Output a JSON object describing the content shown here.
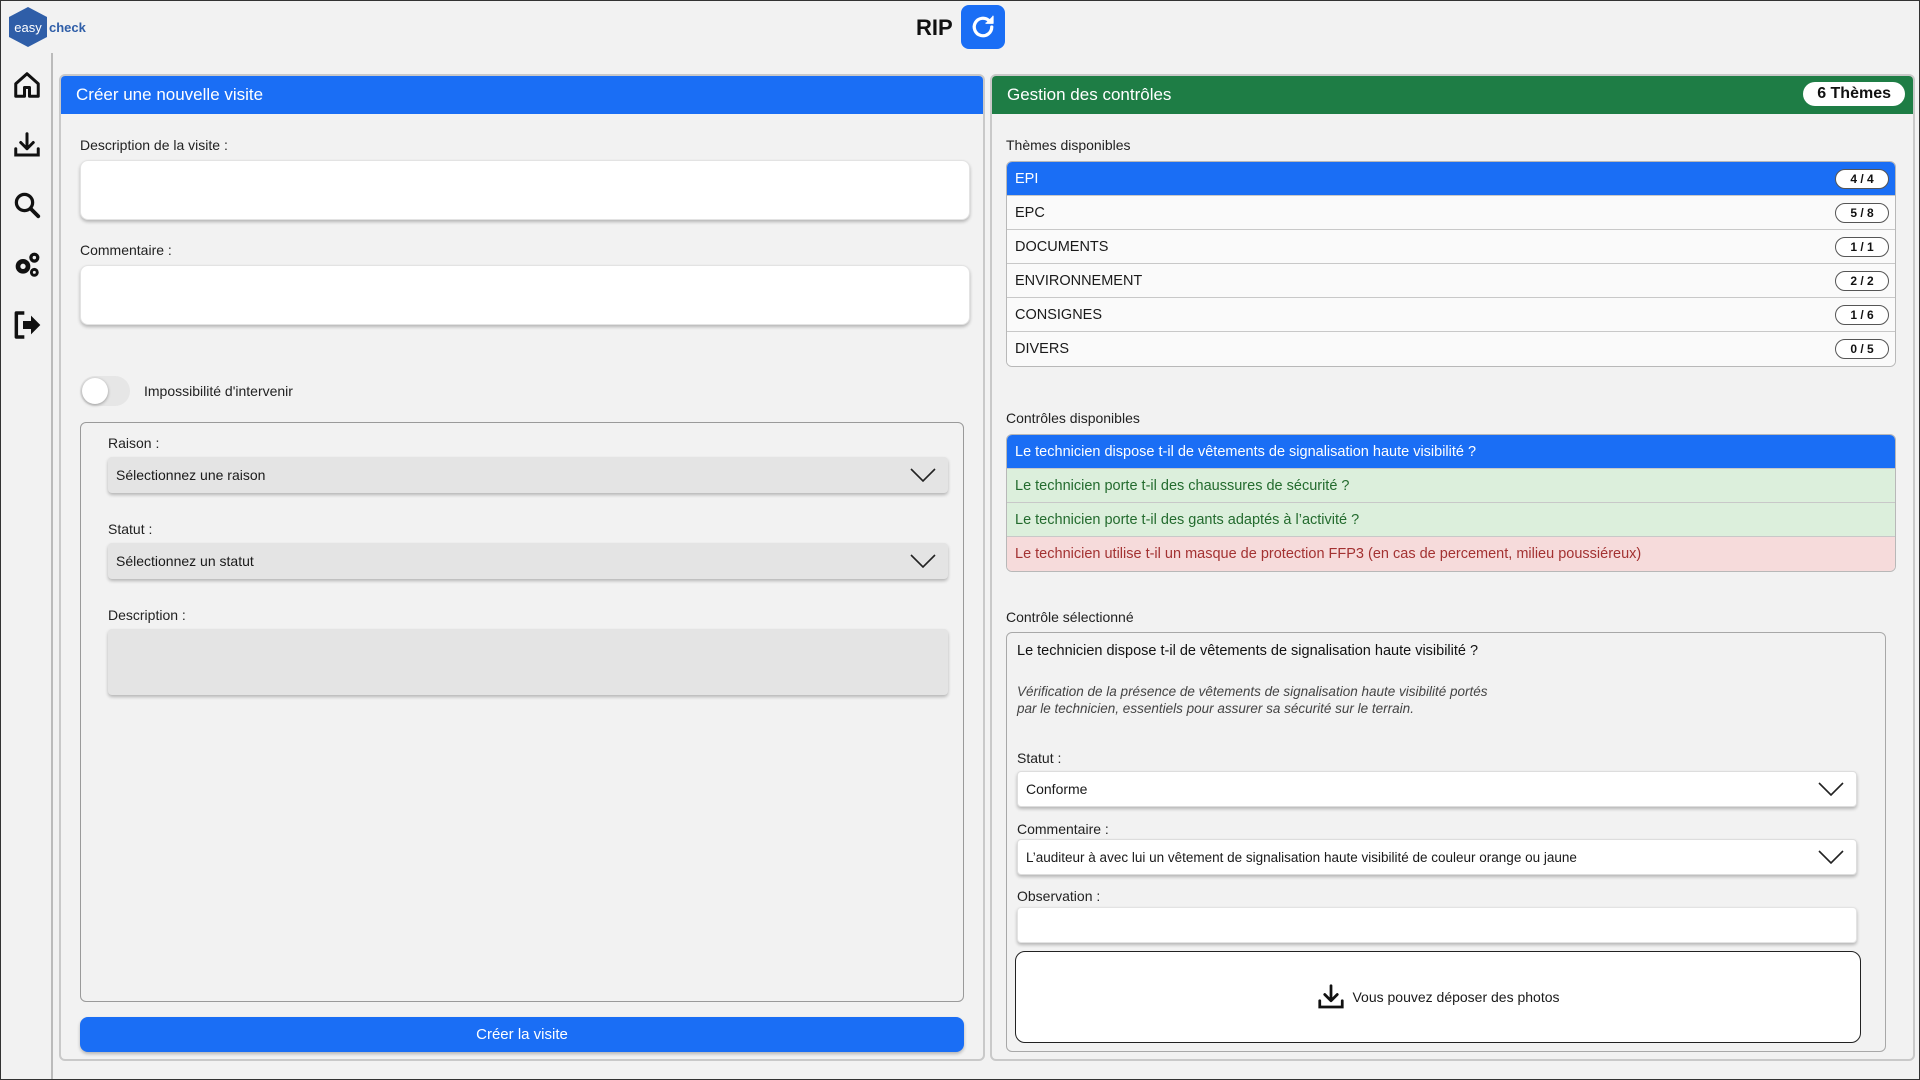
{
  "app": {
    "logo_left": "easy",
    "logo_right": "check",
    "title": "RIP"
  },
  "colors": {
    "primary": "#1a6ef5",
    "success_header": "#1e7d45",
    "conforme_bg": "#dcefdc",
    "nonconforme_bg": "#f6dbdb"
  },
  "sidebar": {
    "icons": [
      "home-icon",
      "download-icon",
      "search-icon",
      "settings-icon",
      "logout-icon"
    ]
  },
  "left": {
    "header": "Créer une nouvelle visite",
    "description_label": "Description de la visite :",
    "description_value": "",
    "comment_label": "Commentaire :",
    "comment_value": "",
    "toggle_label": "Impossibilité d'intervenir",
    "toggle_on": false,
    "raison_label": "Raison :",
    "raison_value": "Sélectionnez une raison",
    "statut_label": "Statut :",
    "statut_value": "Sélectionnez un statut",
    "desc_label": "Description :",
    "create_button": "Créer la visite"
  },
  "right": {
    "header": "Gestion des contrôles",
    "themes_badge": "6 Thèmes",
    "themes_label": "Thèmes disponibles",
    "themes": [
      {
        "name": "EPI",
        "count": "4 / 4",
        "active": true
      },
      {
        "name": "EPC",
        "count": "5 / 8",
        "active": false
      },
      {
        "name": "DOCUMENTS",
        "count": "1 / 1",
        "active": false
      },
      {
        "name": "ENVIRONNEMENT",
        "count": "2 / 2",
        "active": false
      },
      {
        "name": "CONSIGNES",
        "count": "1 / 6",
        "active": false
      },
      {
        "name": "DIVERS",
        "count": "0 / 5",
        "active": false
      }
    ],
    "controls_label": "Contrôles disponibles",
    "controls": [
      {
        "text": "Le technicien dispose t-il de vêtements de signalisation haute visibilité ?",
        "state": "active"
      },
      {
        "text": "Le technicien porte t-il des chaussures de sécurité ?",
        "state": "conforme"
      },
      {
        "text": "Le technicien porte t-il des gants adaptés à l’activité ?",
        "state": "conforme"
      },
      {
        "text": "Le technicien utilise t-il un masque de protection FFP3 (en cas de percement, milieu poussiéreux)",
        "state": "non-conforme"
      }
    ],
    "selected_label": "Contrôle sélectionné",
    "selected": {
      "title": "Le technicien dispose t-il de vêtements de signalisation haute visibilité ?",
      "description": "Vérification de la présence de vêtements de signalisation haute visibilité portés par le technicien, essentiels pour assurer sa sécurité sur le terrain.",
      "statut_label": "Statut :",
      "statut_value": "Conforme",
      "comment_label": "Commentaire :",
      "comment_value": "L’auditeur à avec lui un vêtement de signalisation haute visibilité de couleur orange ou jaune",
      "observation_label": "Observation :",
      "observation_value": "",
      "drop_text": "Vous pouvez déposer des photos"
    }
  }
}
